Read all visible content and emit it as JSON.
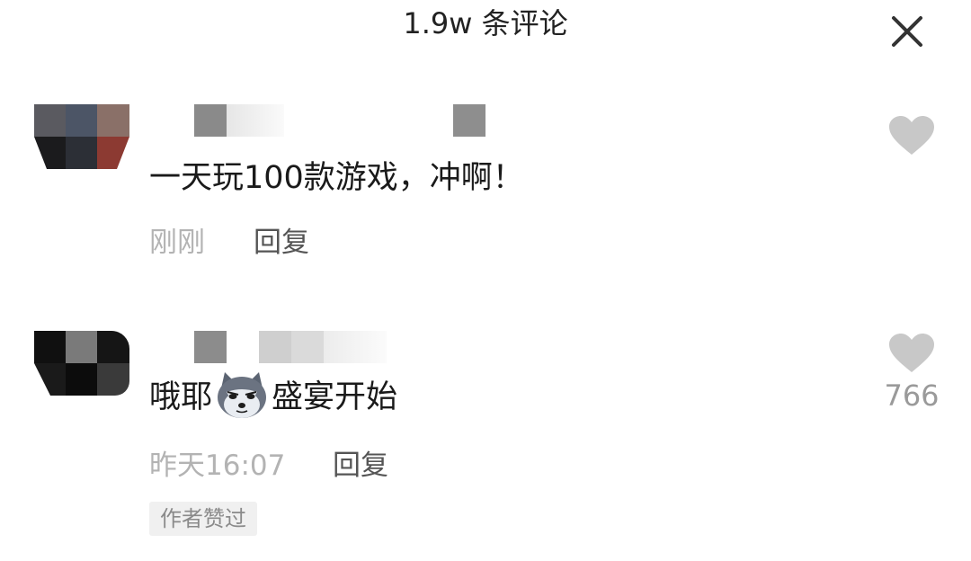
{
  "header": {
    "title": "1.9w 条评论",
    "close_icon": "close-icon"
  },
  "comments": [
    {
      "text": "一天玩100款游戏，冲啊！",
      "time": "刚刚",
      "reply_label": "回复",
      "like_icon": "heart-icon",
      "like_count": ""
    },
    {
      "text_before": "哦耶",
      "emoji": "husky-dog-emoji",
      "text_after": "盛宴开始",
      "time": "昨天16:07",
      "reply_label": "回复",
      "like_icon": "heart-icon",
      "like_count": "766",
      "badge": "作者赞过"
    }
  ],
  "colors": {
    "heart": "#c8c8c8",
    "meta_text": "#b3b3b3",
    "badge_bg": "#f0f0f0"
  }
}
